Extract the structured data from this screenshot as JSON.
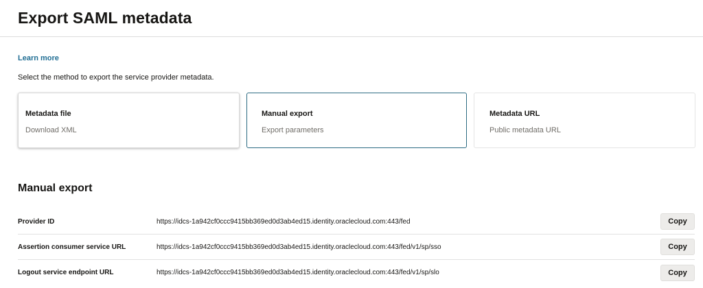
{
  "header": {
    "title": "Export SAML metadata"
  },
  "links": {
    "learn_more": "Learn more"
  },
  "intro_text": "Select the method to export the service provider metadata.",
  "cards": [
    {
      "title": "Metadata file",
      "description": "Download XML"
    },
    {
      "title": "Manual export",
      "description": "Export parameters",
      "selected": true
    },
    {
      "title": "Metadata URL",
      "description": "Public metadata URL"
    }
  ],
  "section": {
    "title": "Manual export"
  },
  "rows": [
    {
      "label": "Provider ID",
      "value": "https://idcs-1a942cf0ccc9415bb369ed0d3ab4ed15.identity.oraclecloud.com:443/fed",
      "button": "Copy"
    },
    {
      "label": "Assertion consumer service URL",
      "value": "https://idcs-1a942cf0ccc9415bb369ed0d3ab4ed15.identity.oraclecloud.com:443/fed/v1/sp/sso",
      "button": "Copy"
    },
    {
      "label": "Logout service endpoint URL",
      "value": "https://idcs-1a942cf0ccc9415bb369ed0d3ab4ed15.identity.oraclecloud.com:443/fed/v1/sp/slo",
      "button": "Copy"
    }
  ],
  "colors": {
    "link": "#1f6d93",
    "selected_border": "#2b6a82",
    "button_bg": "#edecea"
  }
}
